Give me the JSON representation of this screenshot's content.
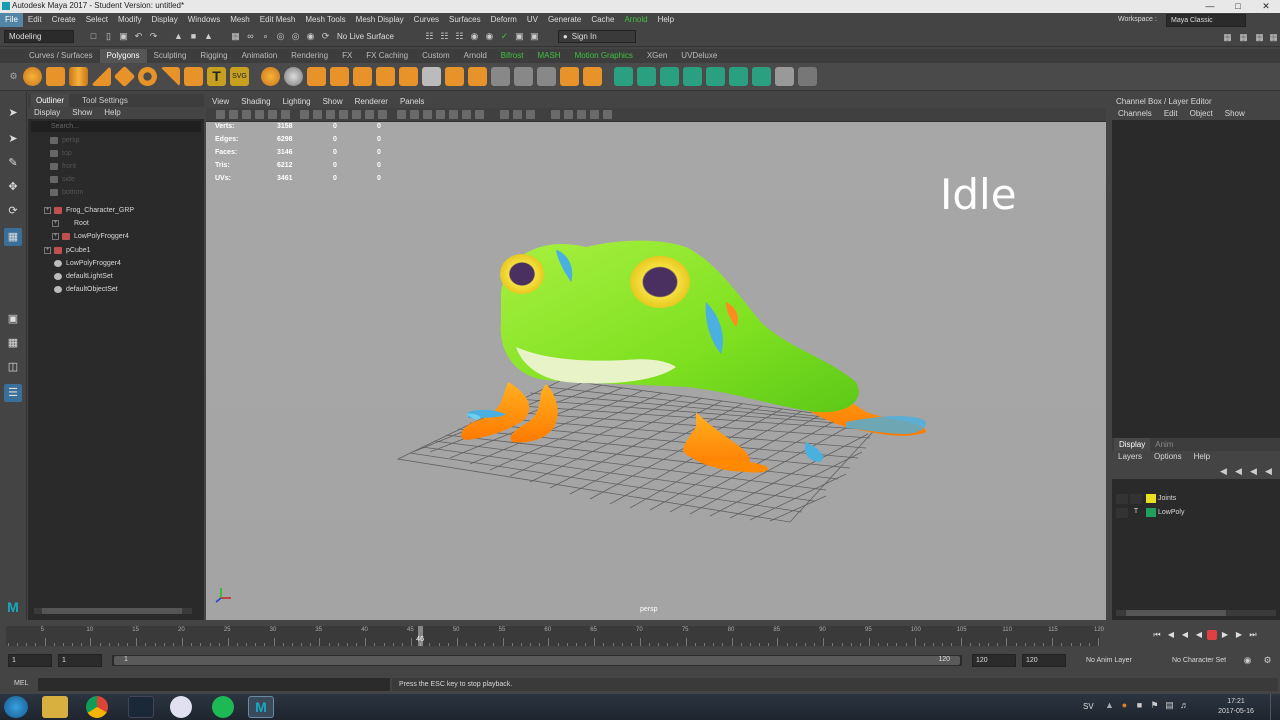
{
  "window": {
    "title": "Autodesk Maya 2017 - Student Version: untitled*"
  },
  "menubar": {
    "items": [
      "File",
      "Edit",
      "Create",
      "Select",
      "Modify",
      "Display",
      "Windows",
      "Mesh",
      "Edit Mesh",
      "Mesh Tools",
      "Mesh Display",
      "Curves",
      "Surfaces",
      "Deform",
      "UV",
      "Generate",
      "Cache",
      "Arnold",
      "Help"
    ],
    "workspace_label": "Workspace :",
    "workspace_value": "Maya Classic"
  },
  "statusline": {
    "mode": "Modeling",
    "live_surface": "No Live Surface",
    "sign_in": "Sign In"
  },
  "shelf": {
    "tabs": [
      "Curves / Surfaces",
      "Polygons",
      "Sculpting",
      "Rigging",
      "Animation",
      "Rendering",
      "FX",
      "FX Caching",
      "Custom",
      "Arnold",
      "Bifrost",
      "MASH",
      "Motion Graphics",
      "XGen",
      "UVDeluxe"
    ],
    "active_tab": "Polygons"
  },
  "outliner": {
    "tabs": [
      "Outliner",
      "Tool Settings"
    ],
    "menu": [
      "Display",
      "Show",
      "Help"
    ],
    "search_placeholder": "Search...",
    "items": [
      {
        "label": "persp"
      },
      {
        "label": "top"
      },
      {
        "label": "front"
      },
      {
        "label": "side"
      },
      {
        "label": "bottom"
      },
      {
        "label": "Frog_Character_GRP"
      },
      {
        "label": "Root"
      },
      {
        "label": "LowPolyFrogger4"
      },
      {
        "label": "pCube1"
      },
      {
        "label": "LowPolyFrogger4"
      },
      {
        "label": "defaultLightSet"
      },
      {
        "label": "defaultObjectSet"
      }
    ]
  },
  "viewport": {
    "menu": [
      "View",
      "Shading",
      "Lighting",
      "Show",
      "Renderer",
      "Panels"
    ],
    "hud": [
      {
        "label": "Verts:",
        "a": "3158",
        "b": "0",
        "c": "0"
      },
      {
        "label": "Edges:",
        "a": "6298",
        "b": "0",
        "c": "0"
      },
      {
        "label": "Faces:",
        "a": "3146",
        "b": "0",
        "c": "0"
      },
      {
        "label": "Tris:",
        "a": "6212",
        "b": "0",
        "c": "0"
      },
      {
        "label": "UVs:",
        "a": "3461",
        "b": "0",
        "c": "0"
      }
    ],
    "overlay_text": "Idle",
    "camera_label": "persp"
  },
  "channelbox": {
    "title": "Channel Box / Layer Editor",
    "menu": [
      "Channels",
      "Edit",
      "Object",
      "Show"
    ],
    "layer_tabs": [
      "Display",
      "Anim"
    ],
    "layer_menu": [
      "Layers",
      "Options",
      "Help"
    ],
    "layers": [
      {
        "v": "",
        "t": "",
        "name": "Joints",
        "color": "#e8e020"
      },
      {
        "v": "",
        "t": "T",
        "name": "LowPoly",
        "color": "#1fa060"
      }
    ]
  },
  "timeline": {
    "ticks": [
      "5",
      "10",
      "15",
      "20",
      "25",
      "30",
      "35",
      "40",
      "45",
      "50",
      "55",
      "60",
      "65",
      "70",
      "75",
      "80",
      "85",
      "90",
      "95",
      "100",
      "105",
      "110",
      "115",
      "120"
    ],
    "current_frame": "46"
  },
  "range": {
    "start": "1",
    "inner_start": "1",
    "slider_start": "1",
    "slider_end": "120",
    "end": "120",
    "outer_end": "120",
    "anim_layer": "No Anim Layer",
    "character_set": "No Character Set"
  },
  "cmdline": {
    "mel_label": "MEL",
    "help_text": "Press the ESC key to stop playback."
  },
  "taskbar": {
    "lang": "SV",
    "time": "17:21",
    "date": "2017-05-16"
  }
}
